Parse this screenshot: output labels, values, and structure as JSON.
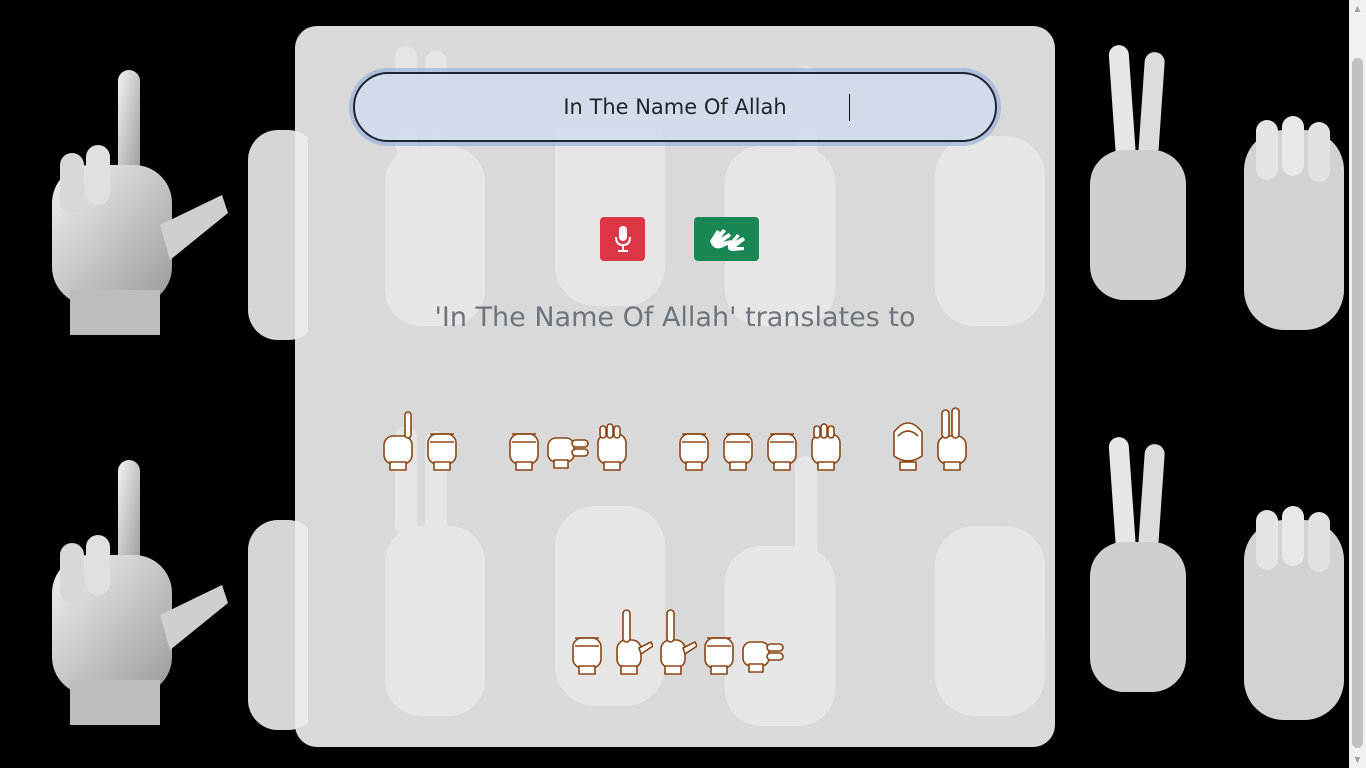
{
  "input": {
    "value": "In The Name Of Allah",
    "caret_visible": true
  },
  "buttons": {
    "mic_icon": "microphone-icon",
    "sign_icon": "sign-language-icon"
  },
  "result": {
    "heading": "'In The Name Of Allah' translates to",
    "words": [
      [
        "I",
        "N"
      ],
      [
        "T",
        "H",
        "E"
      ],
      [
        "N",
        "A",
        "M",
        "E"
      ],
      [
        "O",
        "F"
      ],
      [
        "A",
        "L",
        "L",
        "A",
        "H"
      ]
    ]
  },
  "colors": {
    "mic_button": "#dc3545",
    "sign_button": "#198754",
    "card": "#ececec",
    "sign_stroke": "#8b4513"
  }
}
